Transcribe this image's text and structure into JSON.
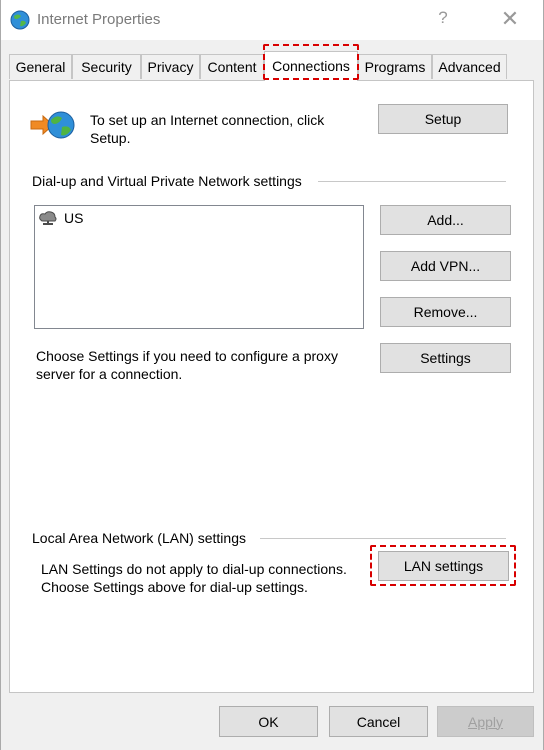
{
  "window": {
    "title": "Internet Properties",
    "help_label": "?",
    "close_label": "✕"
  },
  "tabs": [
    {
      "label": "General"
    },
    {
      "label": "Security"
    },
    {
      "label": "Privacy"
    },
    {
      "label": "Content"
    },
    {
      "label": "Connections",
      "active": true
    },
    {
      "label": "Programs"
    },
    {
      "label": "Advanced"
    }
  ],
  "setup": {
    "text": "To set up an Internet connection, click Setup.",
    "button_label": "Setup"
  },
  "vpn": {
    "group_label": "Dial-up and Virtual Private Network settings",
    "items": [
      {
        "label": "US",
        "icon": "network-connection-icon"
      }
    ],
    "add_label": "Add...",
    "add_vpn_label": "Add VPN...",
    "remove_label": "Remove...",
    "proxy_text": "Choose Settings if you need to configure a proxy server for a connection.",
    "settings_label": "Settings"
  },
  "lan": {
    "group_label": "Local Area Network (LAN) settings",
    "text": "LAN Settings do not apply to dial-up connections. Choose Settings above for dial-up settings.",
    "button_label": "LAN settings"
  },
  "footer": {
    "ok_label": "OK",
    "cancel_label": "Cancel",
    "apply_label": "Apply"
  },
  "colors": {
    "highlight": "#d80000",
    "panel": "#ffffff",
    "chrome": "#f0f0f0"
  }
}
